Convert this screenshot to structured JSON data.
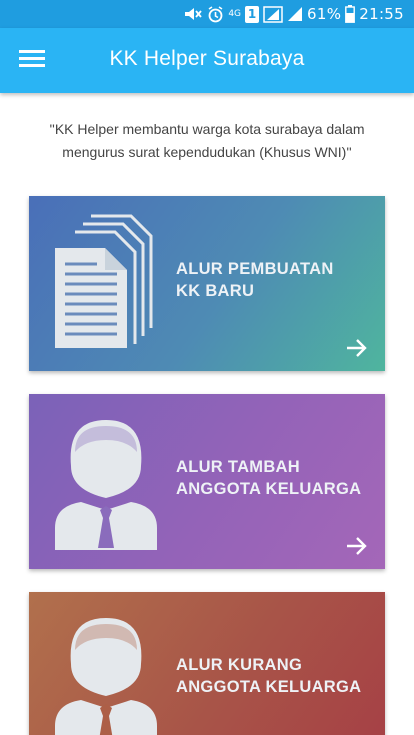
{
  "status_bar": {
    "battery_percent": "61%",
    "time": "21:55",
    "network_label": "4G",
    "sim_label": "1",
    "icons": [
      "mute-icon",
      "alarm-icon",
      "sim-icon",
      "signal-icon",
      "signal-icon",
      "battery-icon"
    ]
  },
  "app_bar": {
    "title": "KK Helper Surabaya",
    "menu_icon": "hamburger-menu-icon"
  },
  "tagline": "''KK Helper membantu warga kota surabaya dalam mengurus surat kependudukan (Khusus WNI)''",
  "cards": [
    {
      "title_line1": "ALUR PEMBUATAN",
      "title_line2": "KK BARU",
      "icon": "documents-icon",
      "arrow_icon": "arrow-right-icon",
      "gradient": [
        "#4a6fb8",
        "#4fb59e"
      ]
    },
    {
      "title_line1": "ALUR TAMBAH",
      "title_line2": "ANGGOTA KELUARGA",
      "icon": "person-icon",
      "arrow_icon": "arrow-right-icon",
      "gradient": [
        "#7b62b8",
        "#a467b8"
      ]
    },
    {
      "title_line1": "ALUR KURANG",
      "title_line2": "ANGGOTA KELUARGA",
      "icon": "person-icon",
      "arrow_icon": "arrow-right-icon",
      "gradient": [
        "#b1704c",
        "#a63f45"
      ]
    }
  ],
  "colors": {
    "status_bar": "#1f9de0",
    "app_bar": "#2ab4f4",
    "icon_fill": "#e4e8ec"
  }
}
